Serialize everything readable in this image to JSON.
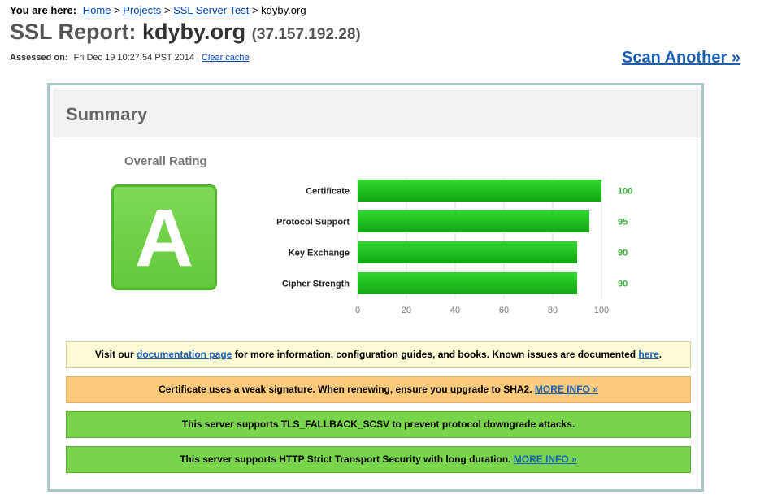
{
  "breadcrumb": {
    "prefix": "You are here:",
    "home": "Home",
    "projects": "Projects",
    "ssl_test": "SSL Server Test",
    "current": "kdyby.org",
    "sep": ">"
  },
  "report": {
    "title_prefix": "SSL Report:",
    "host": "kdyby.org",
    "ip": "(37.157.192.28)"
  },
  "assessed": {
    "label": "Assessed on:",
    "date": "Fri Dec 19 10:27:54 PST 2014",
    "separator": "|",
    "clear_cache": "Clear cache"
  },
  "scan_another": "Scan Another »",
  "summary": {
    "title": "Summary",
    "rating_label": "Overall Rating",
    "grade": "A",
    "grade_color": "#62c83a"
  },
  "chart_data": {
    "type": "bar",
    "orientation": "horizontal",
    "categories": [
      "Certificate",
      "Protocol Support",
      "Key Exchange",
      "Cipher Strength"
    ],
    "values": [
      100,
      95,
      90,
      90
    ],
    "xlim": [
      0,
      100
    ],
    "ticks": [
      0,
      20,
      40,
      60,
      80,
      100
    ],
    "bar_color": "#1cbd1c",
    "value_label_color": "#3bb33b",
    "grid": true
  },
  "banners": {
    "docs": {
      "text_before": "Visit our",
      "link1": "documentation page",
      "text_middle": "for more information, configuration guides, and books. Known issues are documented",
      "link2": "here",
      "text_after": "."
    },
    "weak_sig": {
      "text": "Certificate uses a weak signature. When renewing, ensure you upgrade to SHA2.",
      "link": "MORE INFO »"
    },
    "fallback": {
      "text": "This server supports TLS_FALLBACK_SCSV to prevent protocol downgrade attacks."
    },
    "hsts": {
      "text": "This server supports HTTP Strict Transport Security with long duration.",
      "link": "MORE INFO »"
    }
  }
}
